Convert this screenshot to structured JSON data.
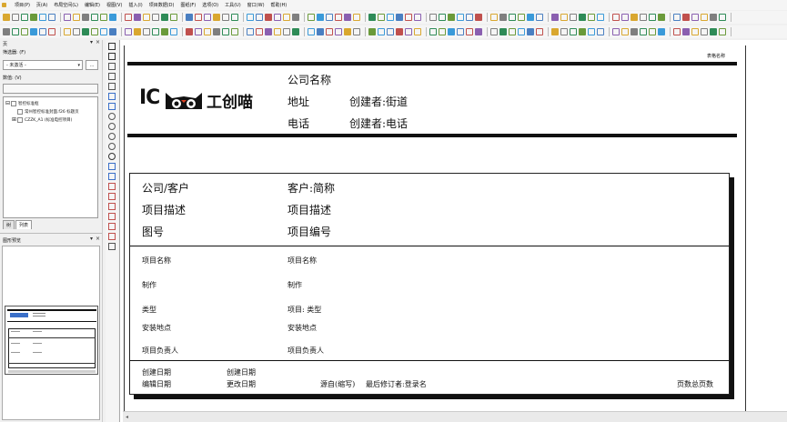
{
  "menu": [
    "项目(P)",
    "页(A)",
    "布局空间(L)",
    "编辑(E)",
    "视图(V)",
    "插入(I)",
    "项目数据(D)",
    "图纸(F)",
    "选项(O)",
    "工具(U)",
    "窗口(W)",
    "帮助(H)"
  ],
  "left_panel": {
    "pages_title": "页",
    "filter_label": "筛选器: (F)",
    "filter_value": "- 未激活 -",
    "filter_button": "...",
    "value_label": "数值: (V)",
    "value_input": "",
    "tree": [
      {
        "label": "智控标准框",
        "level": 0,
        "expander": "⊟"
      },
      {
        "label": "常州智控标准封面.f26 标题页",
        "level": 1,
        "expander": ""
      },
      {
        "label": "CZZK_A1 (标准电控项目)",
        "level": 1,
        "expander": "⊞"
      }
    ],
    "tabs": [
      "树",
      "列表"
    ],
    "preview_title": "图形预览"
  },
  "drawing": {
    "header_right": "表格名称",
    "logo_text": "工创喵",
    "logo_mark": "IC",
    "company_label": "公司名称",
    "address_label": "地址",
    "phone_label": "电话",
    "creator_street": "创建者:街道",
    "creator_phone": "创建者:电话",
    "client_label": "公司/客户",
    "client_value": "客户:简称",
    "desc_label": "项目描述",
    "desc_value": "项目描述",
    "drawing_no_label": "图号",
    "drawing_no_value": "项目编号",
    "rows": [
      {
        "label": "项目名称",
        "value": "项目名称"
      },
      {
        "label": "制作",
        "value": "制作"
      },
      {
        "label": "类型",
        "value": "项目: 类型"
      },
      {
        "label": "安装地点",
        "value": "安装地点"
      },
      {
        "label": "项目负责人",
        "value": "项目负责人"
      }
    ],
    "create_date_label": "创建日期",
    "create_date_value": "创建日期",
    "edit_date_label": "编辑日期",
    "edit_date_value": "更改日期",
    "origin": "源自(缩写)",
    "last_editor": "最后修订者:登录名",
    "page_count": "页数总页数"
  }
}
